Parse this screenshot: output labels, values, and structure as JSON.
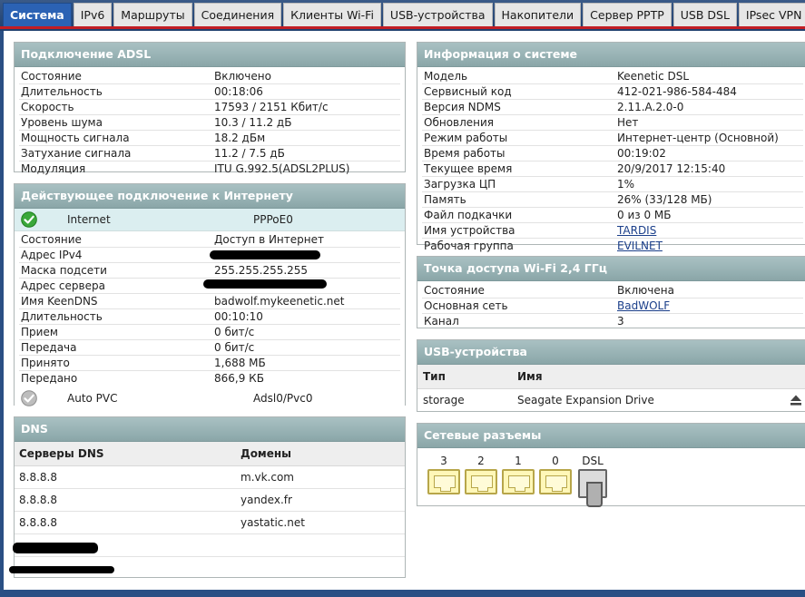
{
  "tabs": [
    {
      "label": "Система",
      "active": true
    },
    {
      "label": "IPv6",
      "active": false
    },
    {
      "label": "Маршруты",
      "active": false
    },
    {
      "label": "Соединения",
      "active": false
    },
    {
      "label": "Клиенты Wi-Fi",
      "active": false
    },
    {
      "label": "USB-устройства",
      "active": false
    },
    {
      "label": "Накопители",
      "active": false
    },
    {
      "label": "Сервер PPTP",
      "active": false
    },
    {
      "label": "USB DSL",
      "active": false
    },
    {
      "label": "IPsec VPN",
      "active": false
    }
  ],
  "adsl": {
    "title": "Подключение ADSL",
    "rows": [
      {
        "k": "Состояние",
        "v": "Включено"
      },
      {
        "k": "Длительность",
        "v": "00:18:06"
      },
      {
        "k": "Скорость",
        "v": "17593 / 2151 Кбит/с"
      },
      {
        "k": "Уровень шума",
        "v": "10.3 / 11.2 дБ"
      },
      {
        "k": "Мощность сигнала",
        "v": "18.2 дБм"
      },
      {
        "k": "Затухание сигнала",
        "v": "11.2 / 7.5 дБ"
      },
      {
        "k": "Модуляция",
        "v": "ITU G.992.5(ADSL2PLUS)"
      }
    ]
  },
  "internet": {
    "title": "Действующее подключение к Интернету",
    "active_conn": {
      "name": "Internet",
      "type": "PPPoE0",
      "icon": "check-circle-icon"
    },
    "rows": [
      {
        "k": "Состояние",
        "v": "Доступ в Интернет"
      },
      {
        "k": "Адрес IPv4",
        "v": ""
      },
      {
        "k": "Маска подсети",
        "v": "255.255.255.255"
      },
      {
        "k": "Адрес сервера",
        "v": ""
      },
      {
        "k": "Имя KeenDNS",
        "v": "badwolf.mykeenetic.net"
      },
      {
        "k": "Длительность",
        "v": "00:10:10"
      },
      {
        "k": "Прием",
        "v": "0 бит/с"
      },
      {
        "k": "Передача",
        "v": "0 бит/с"
      },
      {
        "k": "Принято",
        "v": "1,688 МБ"
      },
      {
        "k": "Передано",
        "v": "866,9 КБ"
      }
    ],
    "other_conn": {
      "name": "Auto PVC",
      "type": "Adsl0/Pvc0",
      "icon": "check-circle-grey-icon"
    }
  },
  "dns": {
    "title": "DNS",
    "col_servers": "Серверы DNS",
    "col_domains": "Домены",
    "rows": [
      {
        "server": "8.8.8.8",
        "domain": "m.vk.com"
      },
      {
        "server": "8.8.8.8",
        "domain": "yandex.fr"
      },
      {
        "server": "8.8.8.8",
        "domain": "yastatic.net"
      },
      {
        "server": "",
        "domain": ""
      },
      {
        "server": "",
        "domain": ""
      }
    ]
  },
  "sysinfo": {
    "title": "Информация о системе",
    "rows": [
      {
        "k": "Модель",
        "v": "Keenetic DSL",
        "link": false
      },
      {
        "k": "Сервисный код",
        "v": "412-021-986-584-484",
        "link": false
      },
      {
        "k": "Версия NDMS",
        "v": "2.11.A.2.0-0",
        "link": false
      },
      {
        "k": "Обновления",
        "v": "Нет",
        "link": false
      },
      {
        "k": "Режим работы",
        "v": "Интернет-центр (Основной)",
        "link": false
      },
      {
        "k": "Время работы",
        "v": "00:19:02",
        "link": false
      },
      {
        "k": "Текущее время",
        "v": "20/9/2017 12:15:40",
        "link": false
      },
      {
        "k": "Загрузка ЦП",
        "v": "1%",
        "link": false
      },
      {
        "k": "Память",
        "v": "26% (33/128 МБ)",
        "link": false
      },
      {
        "k": "Файл подкачки",
        "v": "0 из 0 МБ",
        "link": false
      },
      {
        "k": "Имя устройства",
        "v": "TARDIS",
        "link": true
      },
      {
        "k": "Рабочая группа",
        "v": "EVILNET",
        "link": true
      }
    ]
  },
  "wifi": {
    "title": "Точка доступа Wi-Fi 2,4 ГГц",
    "rows": [
      {
        "k": "Состояние",
        "v": "Включена",
        "link": false
      },
      {
        "k": "Основная сеть",
        "v": "BadWOLF",
        "link": true
      },
      {
        "k": "Канал",
        "v": "3",
        "link": false
      }
    ]
  },
  "usb": {
    "title": "USB-устройства",
    "col_type": "Тип",
    "col_name": "Имя",
    "rows": [
      {
        "type": "storage",
        "name": "Seagate Expansion Drive",
        "icon": "eject-icon"
      }
    ]
  },
  "ports": {
    "title": "Сетевые разъемы",
    "items": [
      {
        "label": "3",
        "kind": "lan"
      },
      {
        "label": "2",
        "kind": "lan"
      },
      {
        "label": "1",
        "kind": "lan"
      },
      {
        "label": "0",
        "kind": "lan"
      },
      {
        "label": "DSL",
        "kind": "dsl"
      }
    ]
  },
  "colors": {
    "accent": "#2b62b4",
    "header": "#1f3f6e",
    "redline": "#c21d24",
    "panel_head": "#97b1b3"
  }
}
